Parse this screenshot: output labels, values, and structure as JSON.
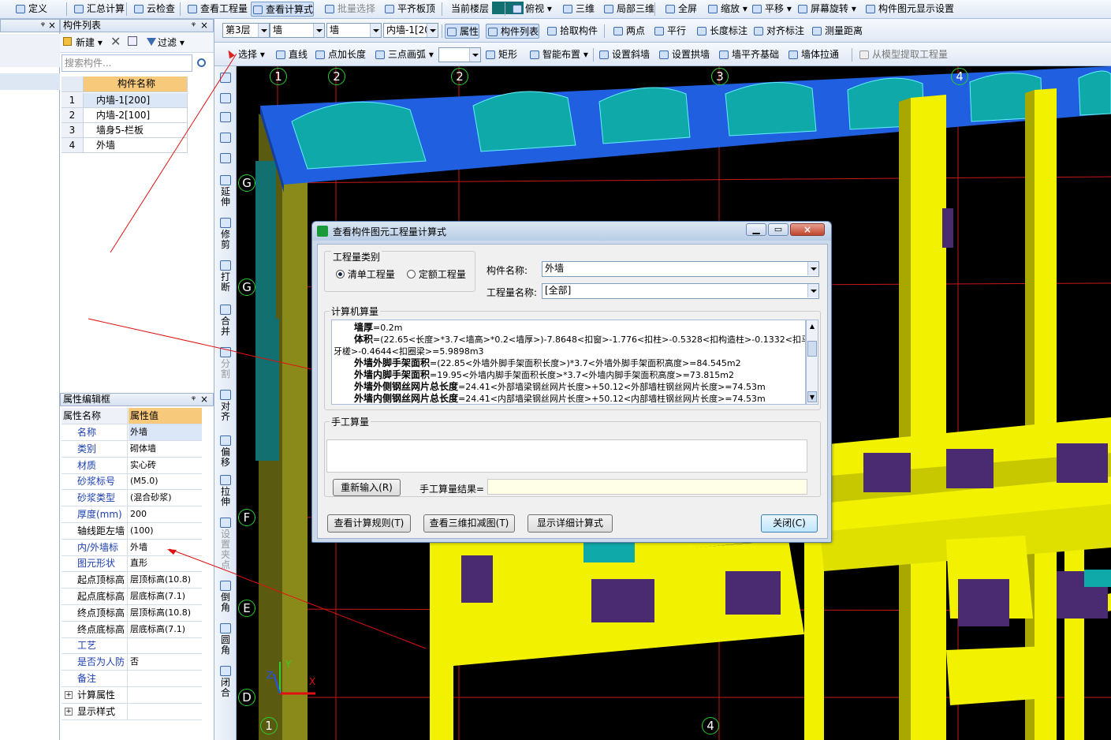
{
  "toolbar1": {
    "items": [
      "定义",
      "汇总计算",
      "云检查",
      "查看工程量",
      "查看计算式",
      "批量选择",
      "平齐板顶",
      "当前楼层",
      "俯视",
      "三维",
      "局部三维",
      "全屏",
      "缩放",
      "平移",
      "屏幕旋转",
      "构件图元显示设置"
    ]
  },
  "toolbar2": {
    "floor": "第3层",
    "type1": "墙",
    "type2": "墙",
    "component": "内墙-1[20",
    "btn_property": "属性",
    "btn_list": "构件列表",
    "btn_pick": "拾取构件",
    "btn_twopoint": "两点",
    "btn_parallel": "平行",
    "btn_length": "长度标注",
    "btn_align": "对齐标注",
    "btn_measure": "测量距离"
  },
  "toolbar3": {
    "select": "选择",
    "line": "直线",
    "point_len": "点加长度",
    "arc": "三点画弧",
    "rect": "矩形",
    "smart": "智能布置",
    "slope": "设置斜墙",
    "arch": "设置拱墙",
    "wall_base": "墙平齐基础",
    "wall_stretch": "墙体拉通",
    "extract": "从模型提取工程量"
  },
  "component_list": {
    "title": "构件列表",
    "new": "新建",
    "filter": "过滤",
    "search_placeholder": "搜索构件...",
    "col_header": "构件名称",
    "rows": [
      {
        "n": "1",
        "name": "内墙-1[200]"
      },
      {
        "n": "2",
        "name": "内墙-2[100]"
      },
      {
        "n": "3",
        "name": "墙身5-栏板"
      },
      {
        "n": "4",
        "name": "外墙"
      }
    ]
  },
  "property_panel": {
    "title": "属性编辑框",
    "col_name": "属性名称",
    "col_value": "属性值",
    "rows": [
      {
        "k": "名称",
        "v": "外墙",
        "blue": true
      },
      {
        "k": "类别",
        "v": "砌体墙",
        "blue": true
      },
      {
        "k": "材质",
        "v": "实心砖",
        "blue": true
      },
      {
        "k": "砂浆标号",
        "v": "(M5.0)",
        "blue": true
      },
      {
        "k": "砂浆类型",
        "v": "(混合砂浆)",
        "blue": true
      },
      {
        "k": "厚度(mm)",
        "v": "200",
        "blue": true
      },
      {
        "k": "轴线距左墙",
        "v": "(100)",
        "blue": false
      },
      {
        "k": "内/外墙标",
        "v": "外墙",
        "blue": true
      },
      {
        "k": "图元形状",
        "v": "直形",
        "blue": true
      },
      {
        "k": "起点顶标高",
        "v": "层顶标高(10.8)",
        "blue": false
      },
      {
        "k": "起点底标高",
        "v": "层底标高(7.1)",
        "blue": false
      },
      {
        "k": "终点顶标高",
        "v": "层顶标高(10.8)",
        "blue": false
      },
      {
        "k": "终点底标高",
        "v": "层底标高(7.1)",
        "blue": false
      },
      {
        "k": "工艺",
        "v": "",
        "blue": true
      },
      {
        "k": "是否为人防",
        "v": "否",
        "blue": true
      },
      {
        "k": "备注",
        "v": "",
        "blue": true
      },
      {
        "k": "计算属性",
        "v": "",
        "blue": false,
        "exp": true
      },
      {
        "k": "显示样式",
        "v": "",
        "blue": false,
        "exp": true
      }
    ]
  },
  "vertical_tools": [
    "延伸",
    "修剪",
    "打断",
    "合并",
    "分割",
    "对齐",
    "偏移",
    "拉伸",
    "设置夹点",
    "倒角",
    "圆角",
    "闭合"
  ],
  "axis_labels": {
    "top": [
      "1",
      "2",
      "2",
      "3",
      "4"
    ],
    "left": [
      "G",
      "G",
      "F",
      "E",
      "D"
    ],
    "bottom": [
      "1",
      "4"
    ]
  },
  "dialog": {
    "title": "查看构件图元工程量计算式",
    "type_group": "工程量类别",
    "radio1": "清单工程量",
    "radio2": "定额工程量",
    "component_label": "构件名称:",
    "component_value": "外墙",
    "qty_label": "工程量名称:",
    "qty_value": "[全部]",
    "computer_group": "计算机算量",
    "lines": [
      {
        "b": "墙厚",
        "t": "=0.2m"
      },
      {
        "b": "体积",
        "t": "=(22.65<长度>*3.7<墙高>*0.2<墙厚>)-7.8648<扣窗>-1.776<扣柱>-0.5328<扣构造柱>-0.1332<扣马"
      },
      {
        "b": "",
        "t": "牙槎>-0.4644<扣圈梁>=5.9898m3"
      },
      {
        "b": "外墙外脚手架面积",
        "t": "=(22.85<外墙外脚手架面积长度>)*3.7<外墙外脚手架面积高度>=84.545m2"
      },
      {
        "b": "外墙内脚手架面积",
        "t": "=19.95<外墙内脚手架面积长度>*3.7<外墙内脚手架面积高度>=73.815m2"
      },
      {
        "b": "外墙外侧钢丝网片总长度",
        "t": "=24.41<外部墙梁钢丝网片长度>+50.12<外部墙柱钢丝网片长度>=74.53m"
      },
      {
        "b": "外墙内侧钢丝网片总长度",
        "t": "=24.41<内部墙梁钢丝网片长度>+50.12<内部墙柱钢丝网片长度>=74.53m"
      }
    ],
    "manual_group": "手工算量",
    "reinput": "重新输入(R)",
    "manual_result_label": "手工算量结果=",
    "btn_rules": "查看计算规则(T)",
    "btn_3d": "查看三维扣减图(T)",
    "btn_detail": "显示详细计算式",
    "btn_close": "关闭(C)"
  },
  "colors": {
    "toolbar": "#dfe8f5",
    "viewport": "#000000",
    "wall_yellow": "#f2f200",
    "beam_blue": "#1f5fe0",
    "window_teal": "#0fa9a9",
    "window_purple": "#4a2a70",
    "axis_green": "#2cd02c",
    "grid_red": "#c81818"
  }
}
